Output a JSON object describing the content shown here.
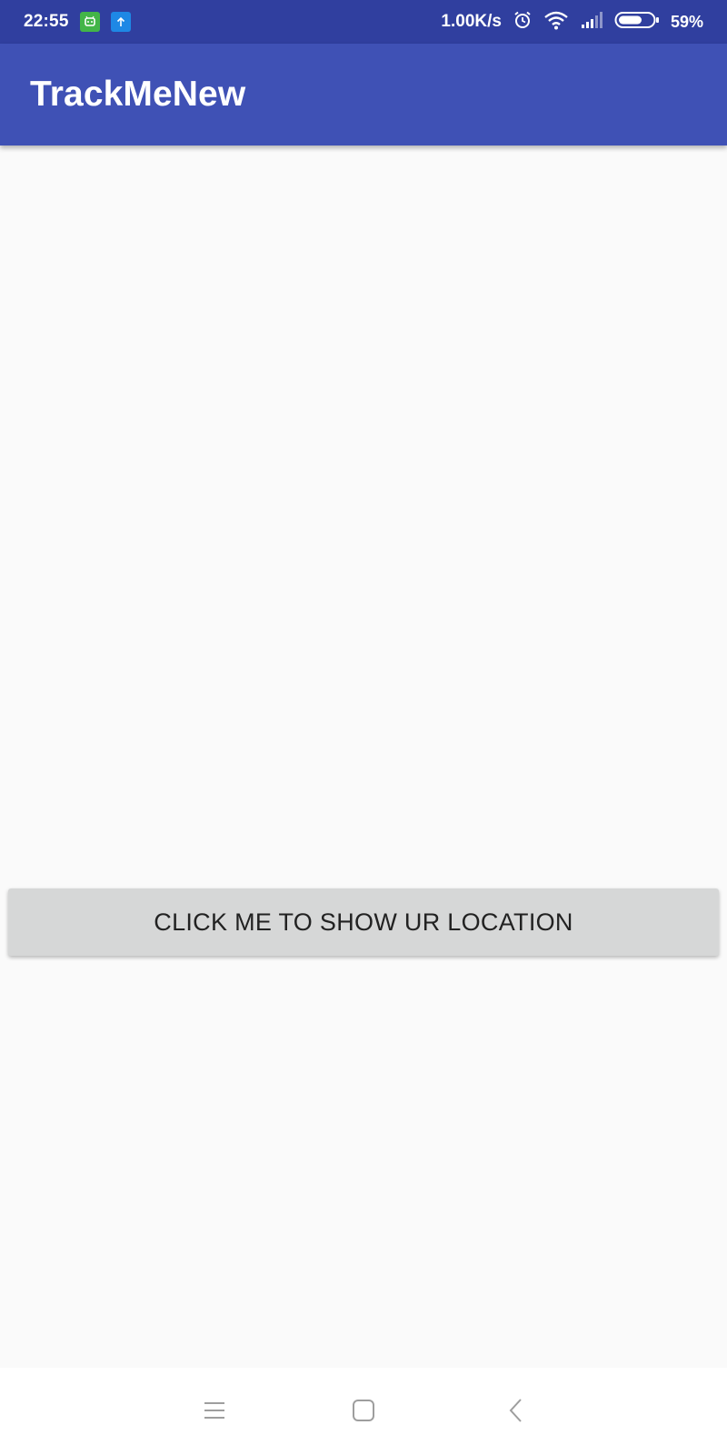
{
  "status_bar": {
    "time": "22:55",
    "notifications": [
      "android-notification-icon",
      "upload-notification-icon"
    ],
    "net_speed": "1.00K/s",
    "icons": [
      "alarm-icon",
      "wifi-icon",
      "signal-icon",
      "battery-icon"
    ],
    "battery_percent": "59%",
    "background_color": "#303f9f"
  },
  "app_bar": {
    "title": "TrackMeNew",
    "background_color": "#3f51b5"
  },
  "main": {
    "button_label": "CLICK ME TO SHOW UR LOCATION",
    "button_color": "#d6d7d7"
  },
  "nav_bar": {
    "buttons": [
      "menu-icon",
      "home-icon",
      "back-icon"
    ]
  }
}
